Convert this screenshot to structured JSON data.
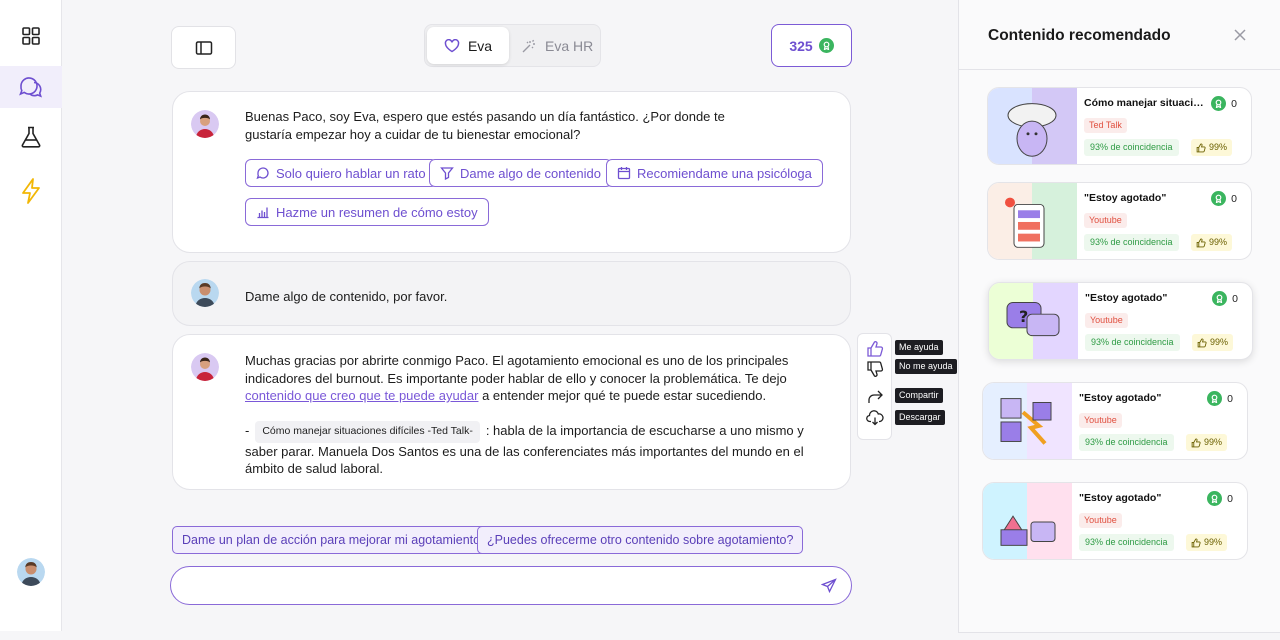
{
  "header": {
    "tabs": [
      {
        "label": "Eva",
        "active": true
      },
      {
        "label": "Eva HR",
        "active": false
      }
    ],
    "points": "325"
  },
  "nav": [
    "grid-icon",
    "chat-icon",
    "flask-icon",
    "lightning-icon"
  ],
  "messages": {
    "greeting": "Buenas Paco, soy Eva, espero que estés pasando un día fantástico. ¿Por donde te gustaría empezar hoy a cuidar de tu bienestar emocional?",
    "chips": [
      "Solo quiero hablar un rato",
      "Dame algo de contenido",
      "Recomiendame una psicóloga",
      "Hazme un resumen de cómo estoy"
    ],
    "user": "Dame algo de contenido, por favor.",
    "reply_part1": "Muchas gracias por abrirte conmigo Paco. El agotamiento emocional es uno de los principales indicadores del burnout. Es importante poder hablar de ello y conocer la problemática. Te dejo ",
    "reply_link": "contenido que creo que te puede ayudar",
    "reply_part2": " a entender mejor qué te puede estar sucediendo.",
    "reply_dash": "-",
    "reply_tag": "Cómo manejar situaciones difíciles -Ted Talk-",
    "reply_part3": ": habla de la importancia de escucharse a uno mismo y saber parar.  Manuela Dos Santos es una de las conferenciates más importantes del mundo en el ámbito de salud laboral."
  },
  "tooltips": {
    "helpful": "Me ayuda",
    "not_helpful": "No me ayuda",
    "share": "Compartir",
    "download": "Descargar"
  },
  "suggestions": [
    "Dame un plan de acción para mejorar mi agotamiento",
    "¿Puedes ofrecerme otro contenido sobre agotamiento?"
  ],
  "composer": {
    "placeholder": ""
  },
  "sidebar": {
    "title": "Contenido recomendado",
    "cards": [
      {
        "title": "Cómo manejar situaciones difíciles",
        "source": "Ted Talk",
        "count": "0",
        "match": "93% de  coincidencia",
        "likes": "99%",
        "color_a": "#dfe8ff",
        "color_b": "#c9c2f5"
      },
      {
        "title": "\"Estoy agotado\"",
        "source": "Youtube",
        "count": "0",
        "match": "93% de  coincidencia",
        "likes": "99%",
        "color_a": "#fff0e6",
        "color_b": "#d9f5dc"
      },
      {
        "title": "\"Estoy agotado\"",
        "source": "Youtube",
        "count": "0",
        "match": "93% de  coincidencia",
        "likes": "99%",
        "color_a": "#f1ffe0",
        "color_b": "#e6d9ff"
      },
      {
        "title": "\"Estoy agotado\"",
        "source": "Youtube",
        "count": "0",
        "match": "93% de  coincidencia",
        "likes": "99%",
        "color_a": "#e7f0ff",
        "color_b": "#f2e6ff"
      },
      {
        "title": "\"Estoy agotado\"",
        "source": "Youtube",
        "count": "0",
        "match": "93% de  coincidencia",
        "likes": "99%",
        "color_a": "#d7f5ff",
        "color_b": "#ffe3ef"
      }
    ]
  },
  "colors": {
    "accent": "#7c5bd6",
    "success": "#3bb55f",
    "warning": "#f2b705"
  }
}
